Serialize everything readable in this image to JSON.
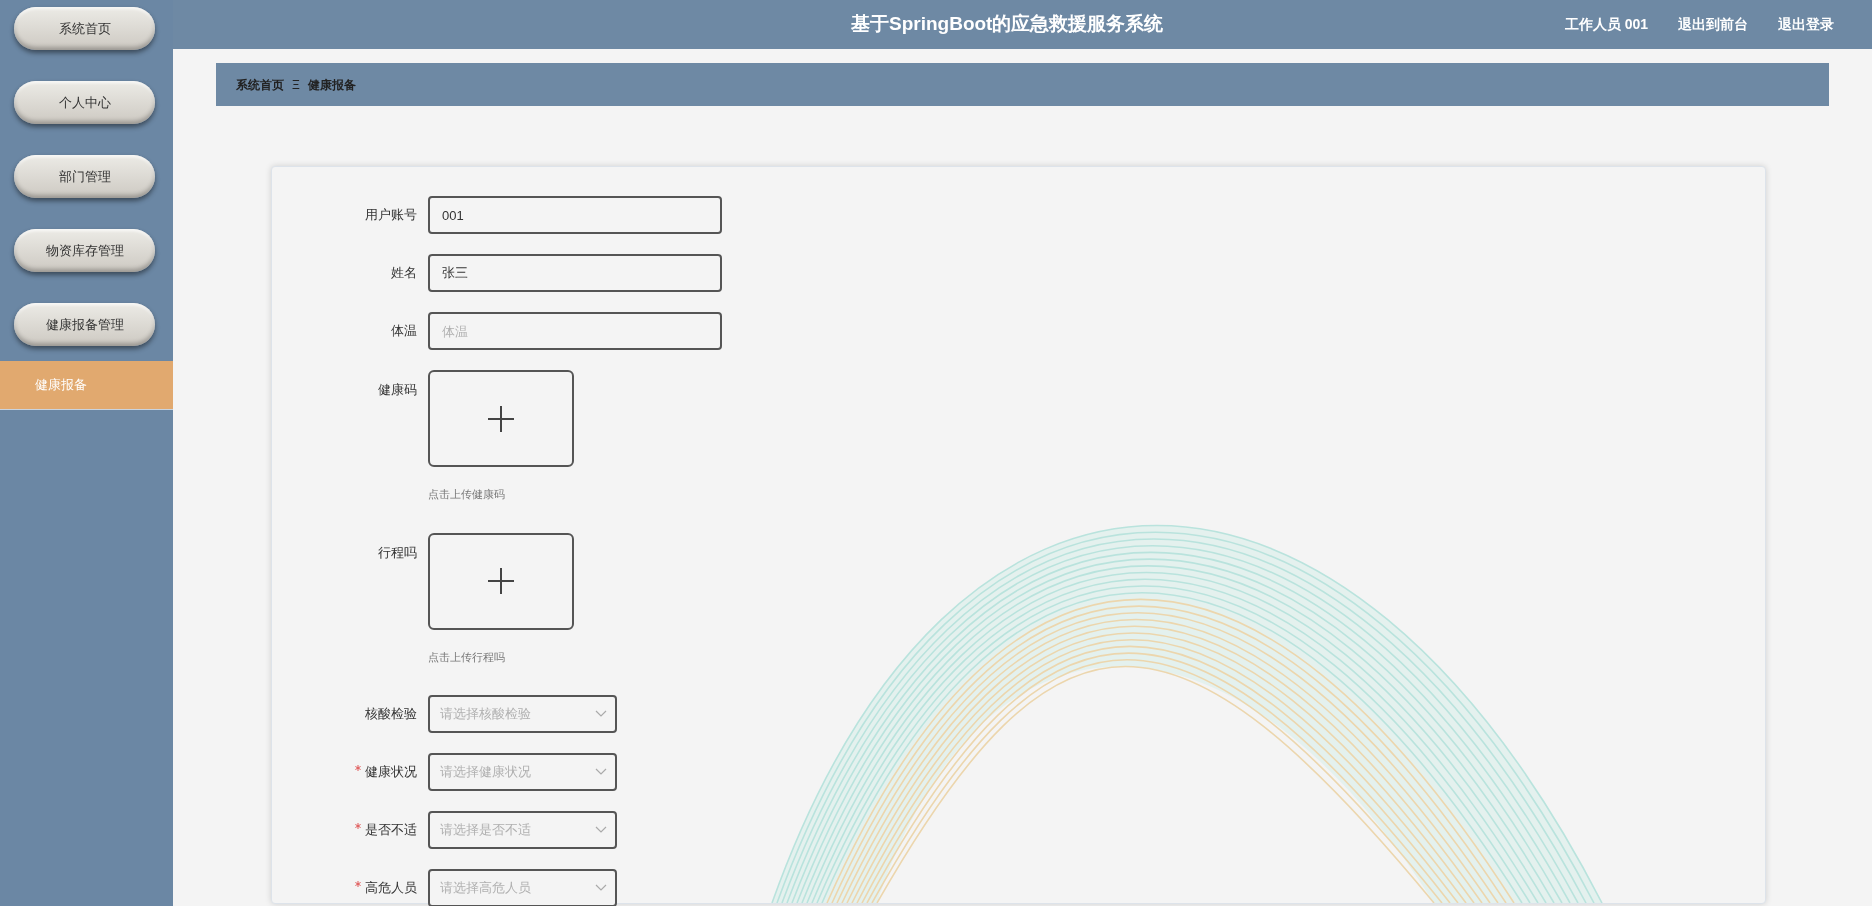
{
  "sidebar": {
    "items": [
      {
        "label": "系统首页",
        "kind": "pill",
        "selected": false
      },
      {
        "label": "个人中心",
        "kind": "pill",
        "selected": false
      },
      {
        "label": "部门管理",
        "kind": "pill",
        "selected": false
      },
      {
        "label": "物资库存管理",
        "kind": "pill",
        "selected": false
      },
      {
        "label": "健康报备管理",
        "kind": "pill",
        "selected": false
      },
      {
        "label": "健康报备",
        "kind": "sub",
        "selected": true
      }
    ]
  },
  "header": {
    "title": "基于SpringBoot的应急救援服务系统",
    "links": [
      "工作人员 001",
      "退出到前台",
      "退出登录"
    ]
  },
  "breadcrumb": {
    "items": [
      "系统首页",
      "健康报备"
    ],
    "separator": "Ξ"
  },
  "form": {
    "fields": [
      {
        "kind": "text",
        "label": "用户账号",
        "required": false,
        "value": "001"
      },
      {
        "kind": "text",
        "label": "姓名",
        "required": false,
        "value": "张三"
      },
      {
        "kind": "text",
        "label": "体温",
        "required": false,
        "placeholder": "体温"
      },
      {
        "kind": "upload",
        "label": "健康码",
        "required": false,
        "hint": "点击上传健康码"
      },
      {
        "kind": "upload",
        "label": "行程吗",
        "required": false,
        "hint": "点击上传行程吗"
      },
      {
        "kind": "select",
        "label": "核酸检验",
        "required": false,
        "placeholder": "请选择核酸检验"
      },
      {
        "kind": "select",
        "label": "健康状况",
        "required": true,
        "placeholder": "请选择健康状况"
      },
      {
        "kind": "select",
        "label": "是否不适",
        "required": true,
        "placeholder": "请选择是否不适"
      },
      {
        "kind": "select",
        "label": "高危人员",
        "required": true,
        "placeholder": "请选择高危人员"
      }
    ]
  }
}
